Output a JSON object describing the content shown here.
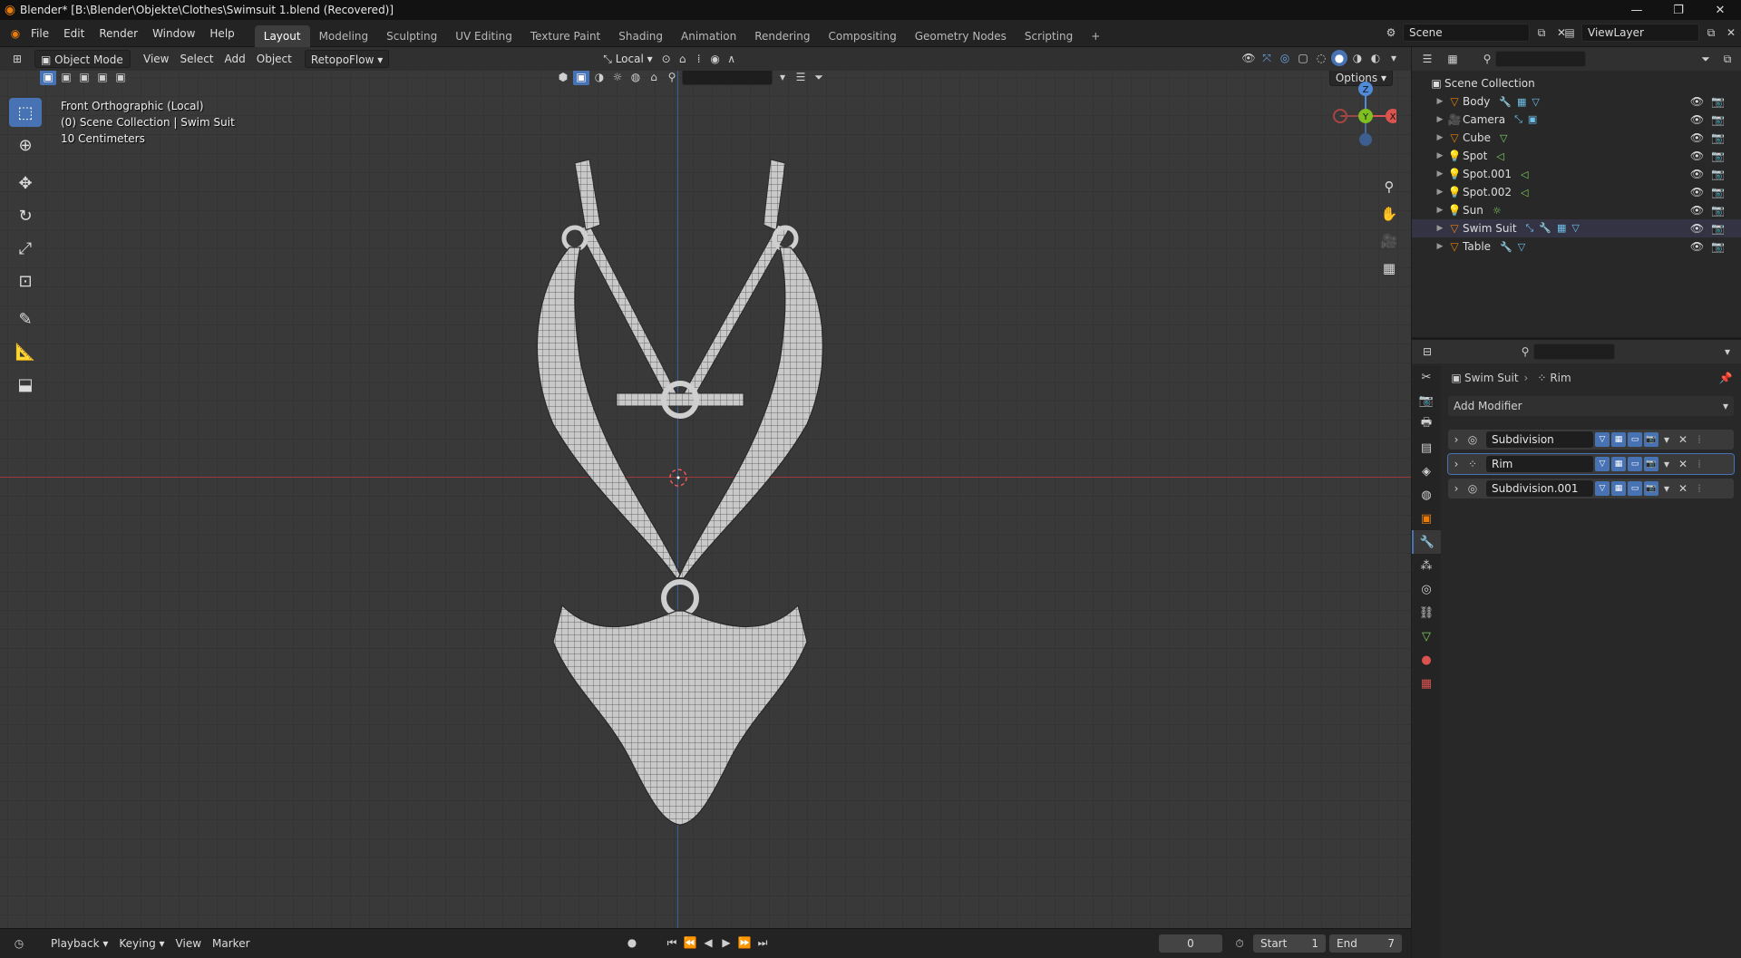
{
  "window": {
    "title": "Blender* [B:\\Blender\\Objekte\\Clothes\\Swimsuit 1.blend (Recovered)]",
    "controls": [
      "—",
      "❐",
      "✕"
    ]
  },
  "menus": [
    "File",
    "Edit",
    "Render",
    "Window",
    "Help"
  ],
  "workspaces": [
    "Layout",
    "Modeling",
    "Sculpting",
    "UV Editing",
    "Texture Paint",
    "Shading",
    "Animation",
    "Rendering",
    "Compositing",
    "Geometry Nodes",
    "Scripting"
  ],
  "active_workspace": "Layout",
  "add_workspace": "+",
  "scene": {
    "name": "Scene",
    "view_layer": "ViewLayer"
  },
  "viewport_header": {
    "mode": "Object Mode",
    "menus": [
      "View",
      "Select",
      "Add",
      "Object"
    ],
    "addon": "RetopoFlow",
    "transform_orientation": "Local",
    "options_label": "Options"
  },
  "viewport": {
    "overlay_lines": [
      "Front Orthographic (Local)",
      "(0) Scene Collection | Swim Suit",
      "10 Centimeters"
    ],
    "gizmo": {
      "z": "Z",
      "y": "Y",
      "x": "X"
    },
    "colors": {
      "x_axis": "#d9534f",
      "y_axis": "#7fbf1f",
      "z_axis": "#4f8bd9",
      "mesh": "#c8c8c8",
      "wire": "#2a2a2a"
    }
  },
  "timeline": {
    "menus": [
      "Playback",
      "Keying",
      "View",
      "Marker"
    ],
    "current_frame": "0",
    "start_label": "Start",
    "start_value": "1",
    "end_label": "End",
    "end_value": "7"
  },
  "outliner": {
    "root": "Scene Collection",
    "items": [
      {
        "name": "Body",
        "icon": "mesh-icon"
      },
      {
        "name": "Camera",
        "icon": "camera-icon"
      },
      {
        "name": "Cube",
        "icon": "mesh-icon"
      },
      {
        "name": "Spot",
        "icon": "light-icon"
      },
      {
        "name": "Spot.001",
        "icon": "light-icon"
      },
      {
        "name": "Spot.002",
        "icon": "light-icon"
      },
      {
        "name": "Sun",
        "icon": "light-icon"
      },
      {
        "name": "Swim Suit",
        "icon": "mesh-icon"
      },
      {
        "name": "Table",
        "icon": "mesh-icon"
      }
    ]
  },
  "properties": {
    "breadcrumb_object": "Swim Suit",
    "breadcrumb_modifier": "Rim",
    "add_modifier_label": "Add Modifier",
    "modifiers": [
      {
        "name": "Subdivision",
        "active": false
      },
      {
        "name": "Rim",
        "active": true
      },
      {
        "name": "Subdivision.001",
        "active": false
      }
    ]
  }
}
